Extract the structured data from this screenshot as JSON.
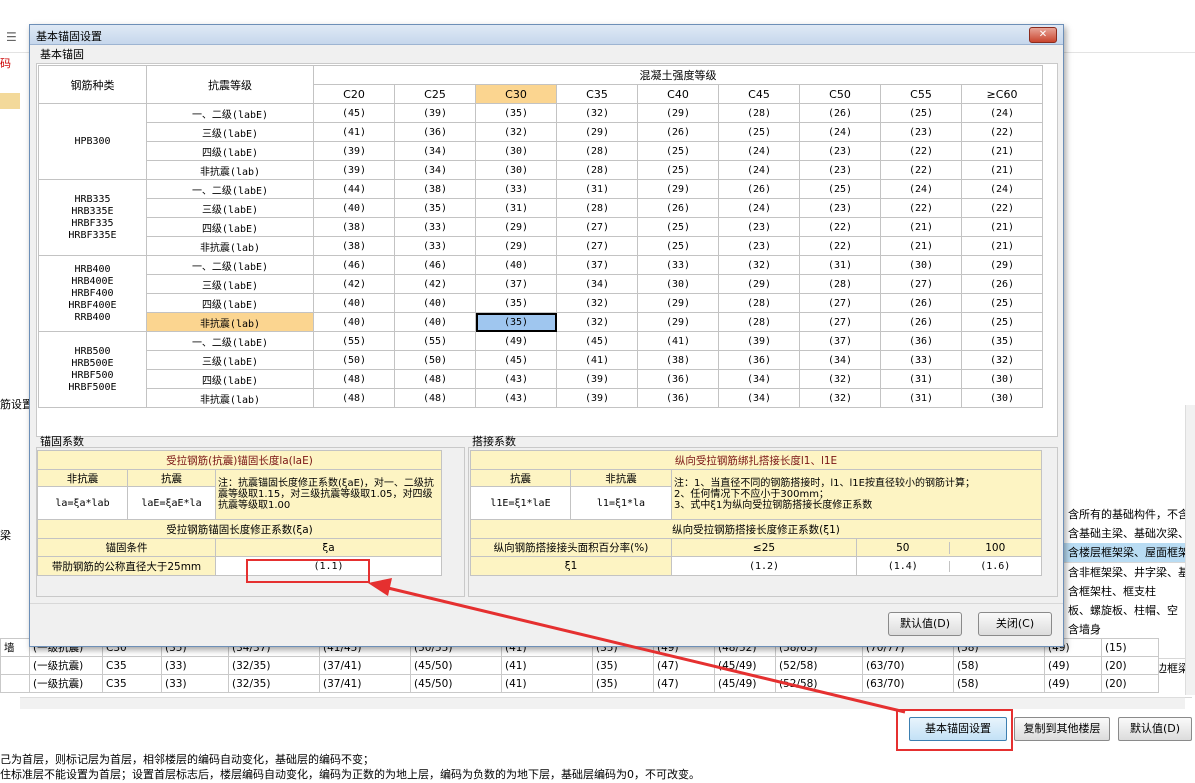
{
  "dialog": {
    "title": "基本锚固设置",
    "anchor_group_label": "基本锚固",
    "header_rebar": "钢筋种类",
    "header_seismic": "抗震等级",
    "header_concrete": "混凝土强度等级",
    "concrete_grades": [
      "C20",
      "C25",
      "C30",
      "C35",
      "C40",
      "C45",
      "C50",
      "C55",
      "≥C60"
    ],
    "rebar_groups": [
      {
        "name": "HPB300",
        "rows": [
          {
            "level": "一、二级(labE)",
            "values": [
              "(45)",
              "(39)",
              "(35)",
              "(32)",
              "(29)",
              "(28)",
              "(26)",
              "(25)",
              "(24)"
            ]
          },
          {
            "level": "三级(labE)",
            "values": [
              "(41)",
              "(36)",
              "(32)",
              "(29)",
              "(26)",
              "(25)",
              "(24)",
              "(23)",
              "(22)"
            ]
          },
          {
            "level": "四级(labE)",
            "values": [
              "(39)",
              "(34)",
              "(30)",
              "(28)",
              "(25)",
              "(24)",
              "(23)",
              "(22)",
              "(21)"
            ]
          },
          {
            "level": "非抗震(lab)",
            "values": [
              "(39)",
              "(34)",
              "(30)",
              "(28)",
              "(25)",
              "(24)",
              "(23)",
              "(22)",
              "(21)"
            ]
          }
        ]
      },
      {
        "name": "HRB335\nHRB335E\nHRBF335\nHRBF335E",
        "rows": [
          {
            "level": "一、二级(labE)",
            "values": [
              "(44)",
              "(38)",
              "(33)",
              "(31)",
              "(29)",
              "(26)",
              "(25)",
              "(24)",
              "(24)"
            ]
          },
          {
            "level": "三级(labE)",
            "values": [
              "(40)",
              "(35)",
              "(31)",
              "(28)",
              "(26)",
              "(24)",
              "(23)",
              "(22)",
              "(22)"
            ]
          },
          {
            "level": "四级(labE)",
            "values": [
              "(38)",
              "(33)",
              "(29)",
              "(27)",
              "(25)",
              "(23)",
              "(22)",
              "(21)",
              "(21)"
            ]
          },
          {
            "level": "非抗震(lab)",
            "values": [
              "(38)",
              "(33)",
              "(29)",
              "(27)",
              "(25)",
              "(23)",
              "(22)",
              "(21)",
              "(21)"
            ]
          }
        ]
      },
      {
        "name": "HRB400\nHRB400E\nHRBF400\nHRBF400E\nRRB400",
        "rows": [
          {
            "level": "一、二级(labE)",
            "values": [
              "(46)",
              "(46)",
              "(40)",
              "(37)",
              "(33)",
              "(32)",
              "(31)",
              "(30)",
              "(29)"
            ]
          },
          {
            "level": "三级(labE)",
            "values": [
              "(42)",
              "(42)",
              "(37)",
              "(34)",
              "(30)",
              "(29)",
              "(28)",
              "(27)",
              "(26)"
            ]
          },
          {
            "level": "四级(labE)",
            "values": [
              "(40)",
              "(40)",
              "(35)",
              "(32)",
              "(29)",
              "(28)",
              "(27)",
              "(26)",
              "(25)"
            ]
          },
          {
            "level": "非抗震(lab)",
            "values": [
              "(40)",
              "(40)",
              "(35)",
              "(32)",
              "(29)",
              "(28)",
              "(27)",
              "(26)",
              "(25)"
            ]
          }
        ]
      },
      {
        "name": "HRB500\nHRB500E\nHRBF500\nHRBF500E",
        "rows": [
          {
            "level": "一、二级(labE)",
            "values": [
              "(55)",
              "(55)",
              "(49)",
              "(45)",
              "(41)",
              "(39)",
              "(37)",
              "(36)",
              "(35)"
            ]
          },
          {
            "level": "三级(labE)",
            "values": [
              "(50)",
              "(50)",
              "(45)",
              "(41)",
              "(38)",
              "(36)",
              "(34)",
              "(33)",
              "(32)"
            ]
          },
          {
            "level": "四级(labE)",
            "values": [
              "(48)",
              "(48)",
              "(43)",
              "(39)",
              "(36)",
              "(34)",
              "(32)",
              "(31)",
              "(30)"
            ]
          },
          {
            "level": "非抗震(lab)",
            "values": [
              "(48)",
              "(48)",
              "(43)",
              "(39)",
              "(36)",
              "(34)",
              "(32)",
              "(31)",
              "(30)"
            ]
          }
        ]
      }
    ],
    "anchor_coef": {
      "group_label": "锚固系数",
      "title": "受拉钢筋(抗震)锚固长度la(laE)",
      "col_nonseismic": "非抗震",
      "col_seismic": "抗震",
      "formula_nonseismic": "la=ξa*lab",
      "formula_seismic": "laE=ξaE*la",
      "note": "注：抗震锚固长度修正系数(ξaE)，对一、二级抗震等级取1.15，对三级抗震等级取1.05，对四级抗震等级取1.00",
      "factor_title": "受拉钢筋锚固长度修正系数(ξa)",
      "cond_header": "锚固条件",
      "xi_header": "ξa",
      "cond_label": "带肋钢筋的公称直径大于25mm",
      "cond_value": "(1.1)"
    },
    "lap_coef": {
      "group_label": "搭接系数",
      "title": "纵向受拉钢筋绑扎搭接长度l1、l1E",
      "col_seismic": "抗震",
      "col_nonseismic": "非抗震",
      "formula_seismic": "l1E=ξ1*laE",
      "formula_nonseismic": "l1=ξ1*la",
      "note": "注：1、当直径不同的钢筋搭接时，l1、l1E按直径较小的钢筋计算；\n2、任何情况下不应小于300mm；\n3、式中ξ1为纵向受拉钢筋搭接长度修正系数",
      "factor_title": "纵向受拉钢筋搭接长度修正系数(ξ1)",
      "pct_label": "纵向钢筋搭接接头面积百分率(%)",
      "pct_values": [
        "≤25",
        "50",
        "100"
      ],
      "xi_label": "ξ1",
      "xi_values": [
        "(1.2)",
        "(1.4)",
        "(1.6)"
      ]
    },
    "default_btn": "默认值(D)",
    "close_btn": "关闭(C)"
  },
  "background": {
    "left_label": "码",
    "section_label": "筋设置",
    "left_row_label": "梁",
    "table_rows": [
      [
        "墙",
        "(一级抗震)",
        "C30",
        "(35)",
        "(34/37)",
        "(41/45)",
        "(50/55)",
        "(41)",
        "(35)",
        "(49)",
        "(48/52)",
        "(58/63)",
        "(70/77)",
        "(58)",
        "(49)",
        "(15)"
      ],
      [
        "",
        "(一级抗震)",
        "C35",
        "(33)",
        "(32/35)",
        "(37/41)",
        "(45/50)",
        "(41)",
        "(35)",
        "(47)",
        "(45/49)",
        "(52/58)",
        "(63/70)",
        "(58)",
        "(49)",
        "(20)"
      ],
      [
        "",
        "(一级抗震)",
        "C35",
        "(33)",
        "(32/35)",
        "(37/41)",
        "(45/50)",
        "(41)",
        "(35)",
        "(47)",
        "(45/49)",
        "(52/58)",
        "(63/70)",
        "(58)",
        "(49)",
        "(20)"
      ]
    ],
    "right_descriptions": [
      "含所有的基础构件，不含",
      "含基础主梁、基础次梁、",
      "含楼层框架梁、屋面框架",
      "含非框架梁、井字梁、基",
      "含框架柱、框支柱",
      "板、螺旋板、柱帽、空",
      "含墙身",
      "人防门框墙",
      "包含连梁、暗梁、边框梁",
      "包含暗柱、端柱"
    ],
    "btn_basic_anchor": "基本锚固设置",
    "btn_copy": "复制到其他楼层",
    "btn_default": "默认值(D)",
    "note1": "己为首层，则标记层为首层，相邻楼层的编码自动变化，基础层的编码不变；",
    "note2": "住标准层不能设置为首层；设置首层标志后，楼层编码自动变化，编码为正数的为地上层，编码为负数的为地下层，基础层编码为0，不可改变。"
  },
  "colors": {
    "highlight": "#fbd590",
    "selection": "#9fc6ef",
    "annotation": "#e53030",
    "yellow_cell": "#fdf4c3"
  }
}
